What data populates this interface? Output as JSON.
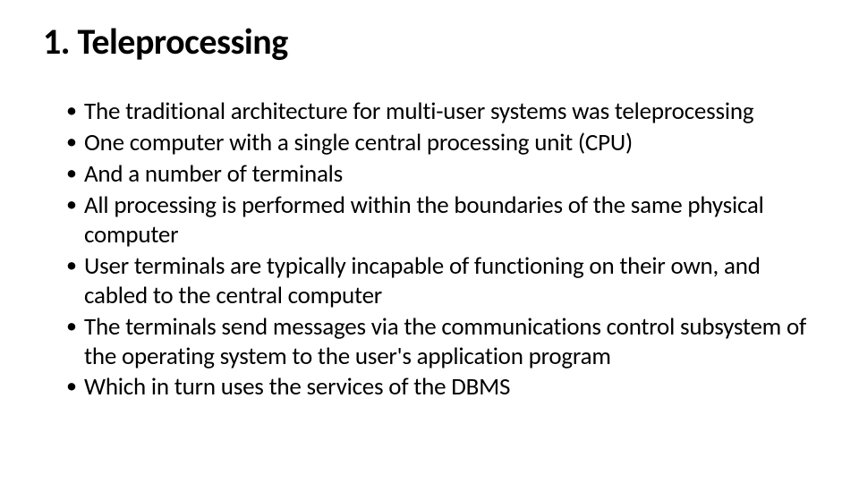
{
  "slide": {
    "title": "1. Teleprocessing",
    "bullets": [
      "The traditional architecture for multi-user systems was teleprocessing",
      "One computer with a single central processing unit (CPU)",
      "And a number of terminals",
      "All processing is performed within the boundaries of the same physical computer",
      "User terminals are typically incapable of functioning on their own, and cabled to the central computer",
      "The terminals send messages via the communications control subsystem of the operating system to the user's application program",
      "Which in turn uses the services of the DBMS"
    ]
  }
}
